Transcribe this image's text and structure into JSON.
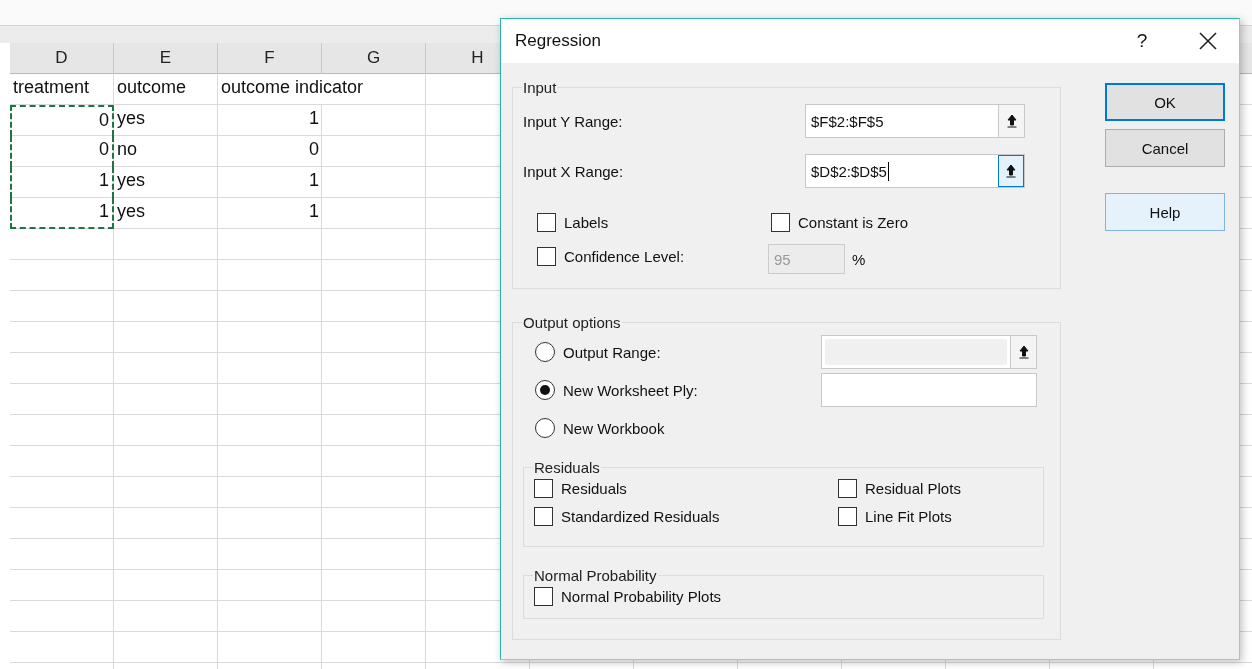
{
  "sheet": {
    "columns": [
      "D",
      "E",
      "F",
      "G",
      "H"
    ],
    "rows": [
      {
        "kind": "header",
        "d": "treatment",
        "e": "outcome",
        "f": "outcome indicator",
        "marked": false
      },
      {
        "kind": "data",
        "d": "0",
        "e": "yes",
        "f": "1",
        "marked": true
      },
      {
        "kind": "data",
        "d": "0",
        "e": "no",
        "f": "0",
        "marked": true
      },
      {
        "kind": "data",
        "d": "1",
        "e": "yes",
        "f": "1",
        "marked": true
      },
      {
        "kind": "data",
        "d": "1",
        "e": "yes",
        "f": "1",
        "marked": true
      }
    ]
  },
  "dialog": {
    "title": "Regression",
    "help_glyph": "?",
    "input": {
      "legend": "Input",
      "ranges": [
        {
          "label": "Input Y Range:",
          "value": "$F$2:$F$5",
          "focused": false
        },
        {
          "label": "Input X Range:",
          "value": "$D$2:$D$5",
          "focused": true
        }
      ],
      "options": [
        {
          "label": "Labels",
          "checked": false
        },
        {
          "label": "Constant is Zero",
          "checked": false
        },
        {
          "label": "Confidence Level:",
          "checked": false,
          "field": {
            "value": "95",
            "disabled": true,
            "unit": "%"
          }
        }
      ]
    },
    "output": {
      "legend": "Output options",
      "choices": [
        {
          "label": "Output Range:",
          "selected": false,
          "field": {
            "disabled": true,
            "picker": true
          }
        },
        {
          "label": "New Worksheet Ply:",
          "selected": true,
          "field": {
            "disabled": false,
            "picker": false
          }
        },
        {
          "label": "New Workbook",
          "selected": false
        }
      ],
      "residuals": {
        "legend": "Residuals",
        "options": [
          {
            "label": "Residuals",
            "checked": false
          },
          {
            "label": "Residual Plots",
            "checked": false
          },
          {
            "label": "Standardized Residuals",
            "checked": false
          },
          {
            "label": "Line Fit Plots",
            "checked": false
          }
        ]
      },
      "normal": {
        "legend": "Normal Probability",
        "options": [
          {
            "label": "Normal Probability Plots",
            "checked": false
          }
        ]
      }
    },
    "buttons": [
      {
        "label": "OK",
        "kind": "default"
      },
      {
        "label": "Cancel",
        "kind": "normal"
      },
      {
        "label": "Help",
        "kind": "hover"
      }
    ]
  }
}
